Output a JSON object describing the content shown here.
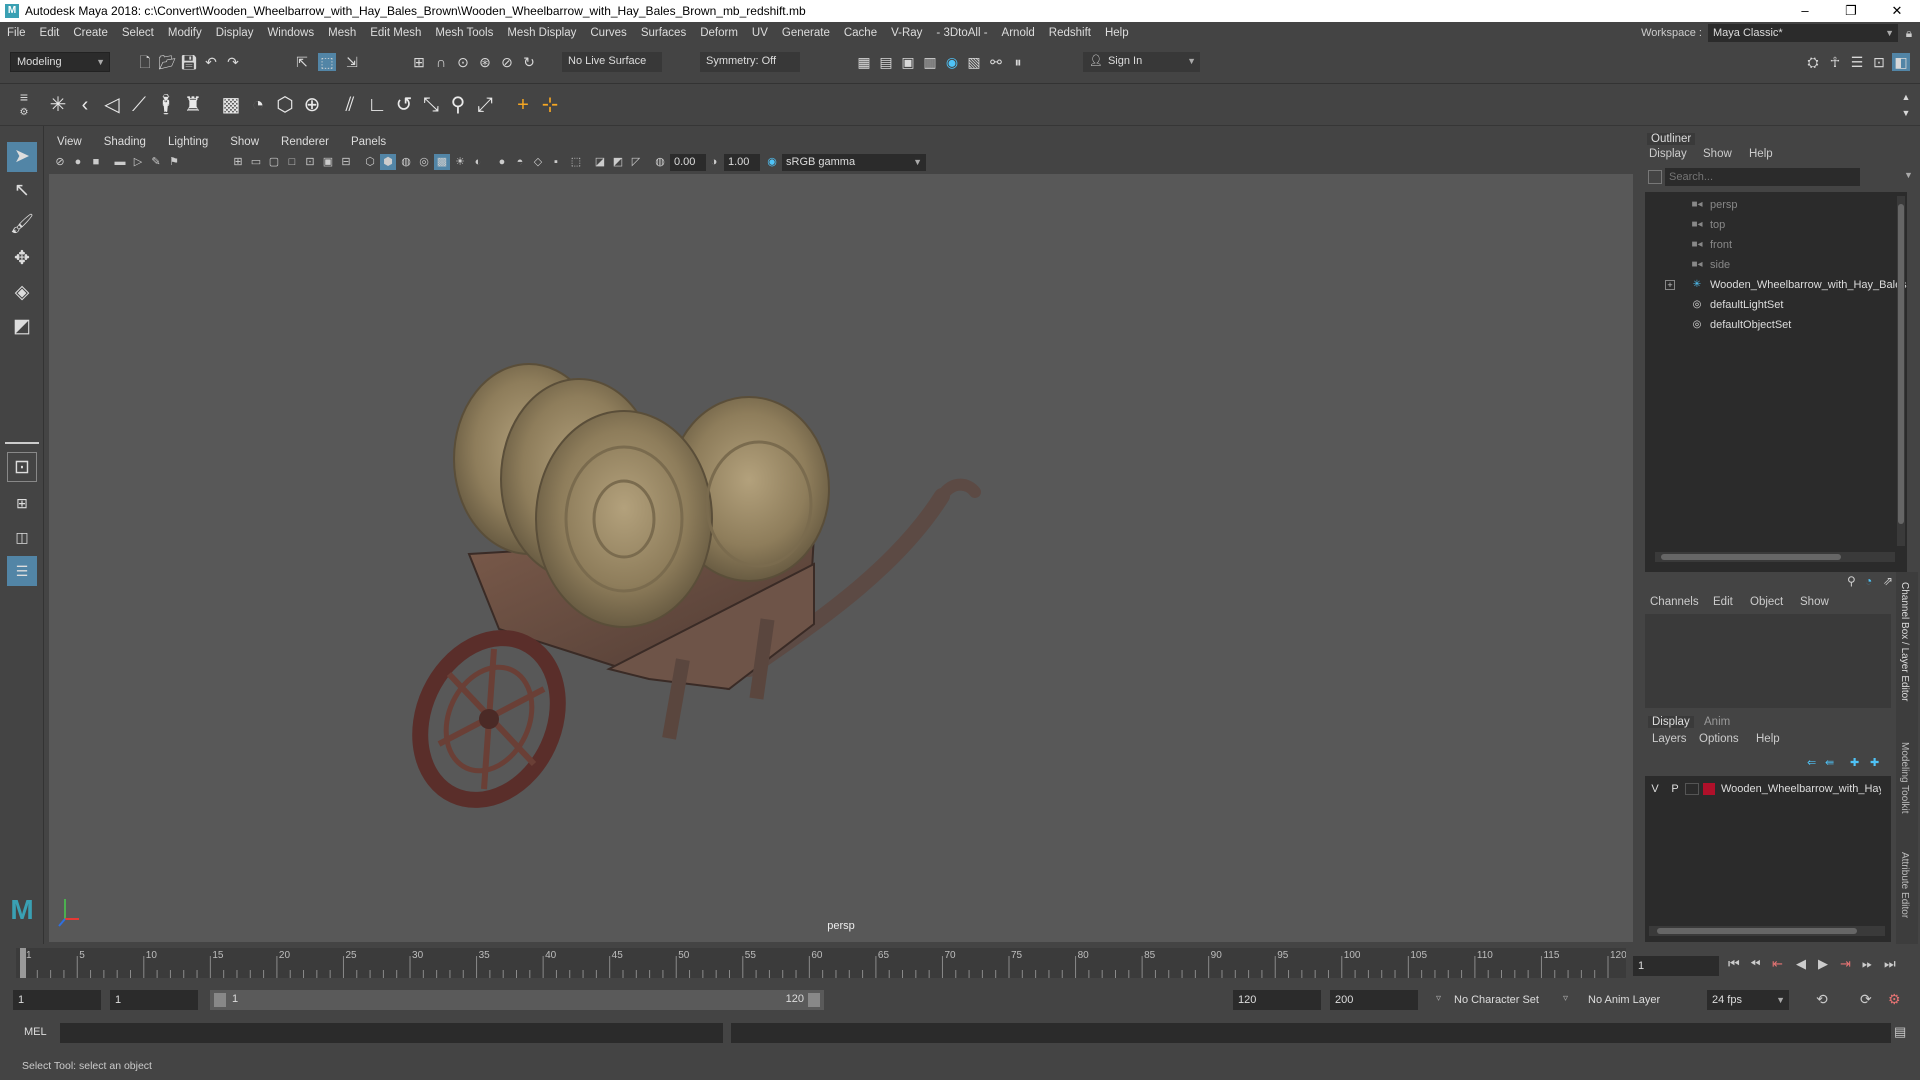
{
  "window": {
    "title": "Autodesk Maya 2018: c:\\Convert\\Wooden_Wheelbarrow_with_Hay_Bales_Brown\\Wooden_Wheelbarrow_with_Hay_Bales_Brown_mb_redshift.mb",
    "icon_letter": "M",
    "minimize": "–",
    "maximize": "❐",
    "close": "✕"
  },
  "menubar": {
    "items": [
      "File",
      "Edit",
      "Create",
      "Select",
      "Modify",
      "Display",
      "Windows",
      "Mesh",
      "Edit Mesh",
      "Mesh Tools",
      "Mesh Display",
      "Curves",
      "Surfaces",
      "Deform",
      "UV",
      "Generate",
      "Cache",
      "V-Ray",
      "- 3DtoAll -",
      "Arnold",
      "Redshift",
      "Help"
    ],
    "workspace_label": "Workspace :",
    "workspace_value": "Maya Classic*"
  },
  "statusline": {
    "mode": "Modeling",
    "live_surface": "No Live Surface",
    "symmetry": "Symmetry: Off",
    "sign_in": "Sign In"
  },
  "viewport": {
    "menus": [
      "View",
      "Shading",
      "Lighting",
      "Show",
      "Renderer",
      "Panels"
    ],
    "exposure": "0.00",
    "gamma": "1.00",
    "color_space": "sRGB gamma",
    "camera_label": "persp"
  },
  "outliner": {
    "title": "Outliner",
    "menus": [
      "Display",
      "Show",
      "Help"
    ],
    "search_placeholder": "Search...",
    "items": [
      {
        "label": "persp",
        "type": "camera"
      },
      {
        "label": "top",
        "type": "camera"
      },
      {
        "label": "front",
        "type": "camera"
      },
      {
        "label": "side",
        "type": "camera"
      },
      {
        "label": "Wooden_Wheelbarrow_with_Hay_Bales",
        "type": "group"
      },
      {
        "label": "defaultLightSet",
        "type": "set"
      },
      {
        "label": "defaultObjectSet",
        "type": "set"
      }
    ]
  },
  "channel_box": {
    "menus": [
      "Channels",
      "Edit",
      "Object",
      "Show"
    ]
  },
  "layer_editor": {
    "tabs": [
      "Display",
      "Anim"
    ],
    "menus": [
      "Layers",
      "Options",
      "Help"
    ],
    "layer": {
      "v": "V",
      "p": "P",
      "name": "Wooden_Wheelbarrow_with_Hay_Bales",
      "color": "#b0102a"
    }
  },
  "side_tabs": [
    "Channel Box / Layer Editor",
    "Modeling Toolkit",
    "Attribute Editor"
  ],
  "timeline": {
    "ticks": [
      "1",
      "5",
      "10",
      "15",
      "20",
      "25",
      "30",
      "35",
      "40",
      "45",
      "50",
      "55",
      "60",
      "65",
      "70",
      "75",
      "80",
      "85",
      "90",
      "95",
      "100",
      "105",
      "110",
      "115",
      "120"
    ],
    "current_frame": "1"
  },
  "range": {
    "start": "1",
    "playback_start": "1",
    "slider_start": "1",
    "slider_end": "120",
    "playback_end": "120",
    "end": "200",
    "character_set": "No Character Set",
    "anim_layer": "No Anim Layer",
    "fps": "24 fps"
  },
  "command": {
    "label": "MEL"
  },
  "help_line": "Select Tool: select an object",
  "colors": {
    "accent_active": "#5285a6",
    "viewport_bg": "#585858"
  }
}
